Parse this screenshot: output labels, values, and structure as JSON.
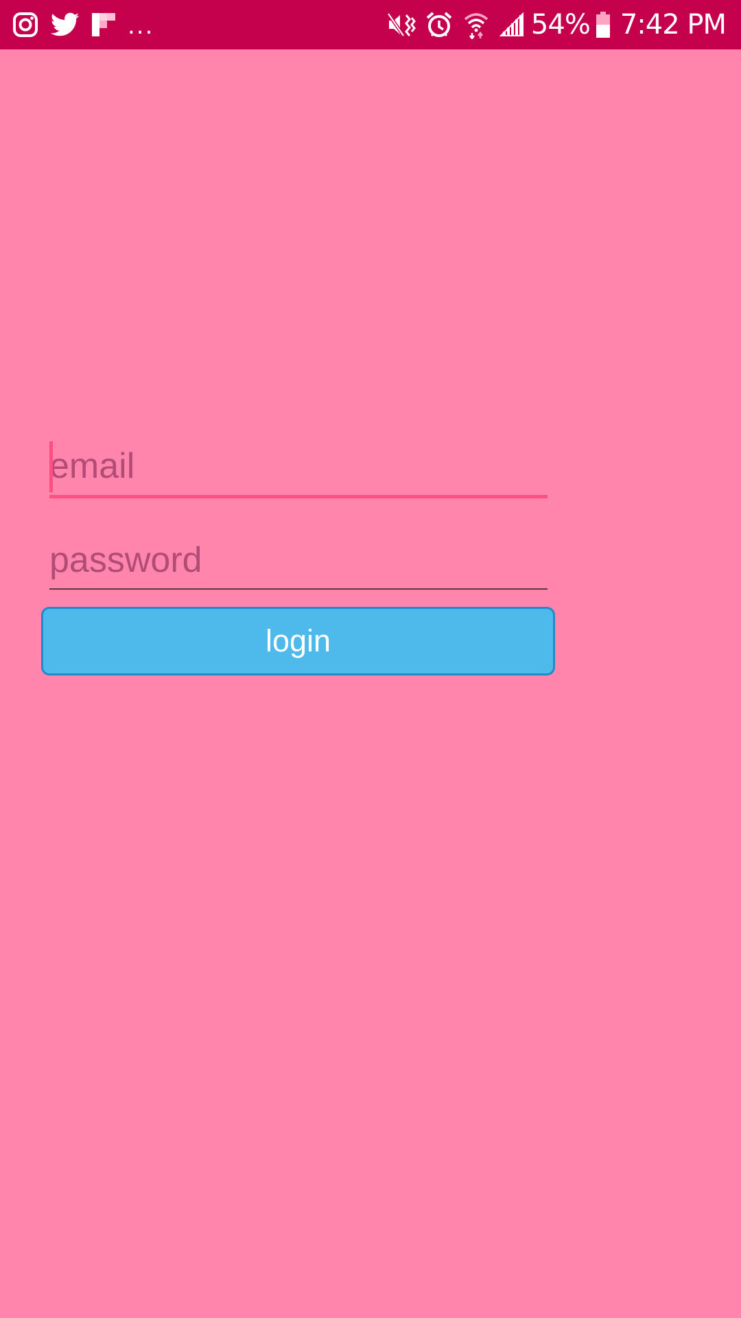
{
  "status_bar": {
    "notification_icons": [
      "instagram-icon",
      "twitter-icon",
      "flipboard-icon"
    ],
    "more_indicator": "...",
    "system_icons": [
      "mute-vibrate-icon",
      "alarm-icon",
      "wifi-icon",
      "signal-icon"
    ],
    "battery_level": "54%",
    "battery_icon": "battery-icon",
    "time": "7:42 PM",
    "background_color": "#c5004d"
  },
  "login_form": {
    "email": {
      "value": "",
      "placeholder": "email"
    },
    "password": {
      "value": "",
      "placeholder": "password"
    },
    "login_button_label": "login"
  },
  "colors": {
    "background": "#ff85ad",
    "accent": "#ff4f82",
    "button": "#4ebaec",
    "button_border": "#1f8cc8",
    "hint_text": "#b04c75"
  }
}
